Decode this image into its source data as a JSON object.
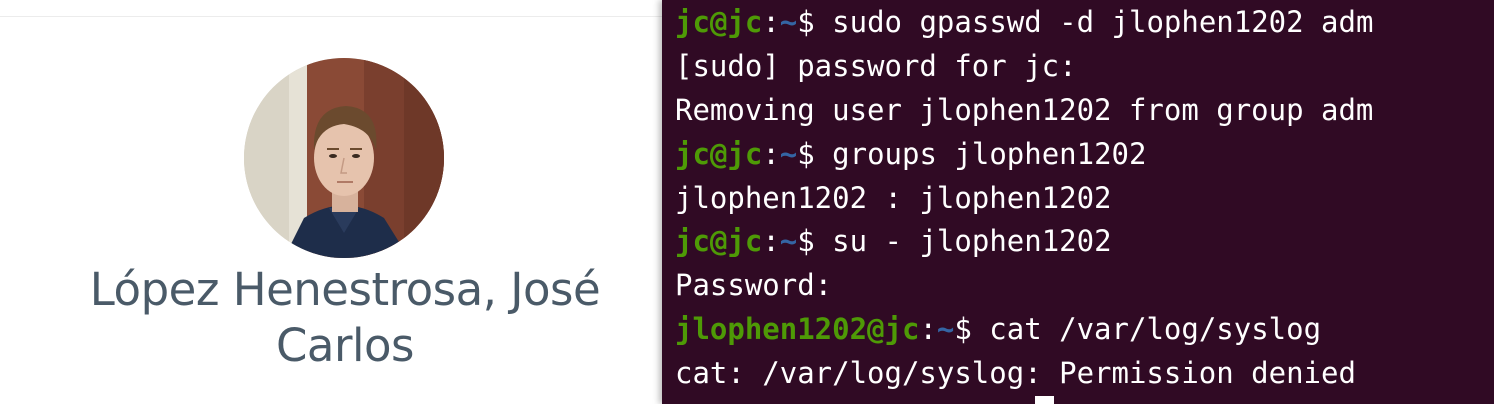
{
  "profile": {
    "name_line1": "López Henestrosa, José",
    "name_line2": "Carlos",
    "avatar_icon": "profile-photo"
  },
  "terminal": {
    "colors": {
      "background": "#300a24",
      "prompt_user": "#4e9a06",
      "prompt_path": "#3465a4",
      "text": "#ffffff"
    },
    "lines": [
      {
        "type": "prompt",
        "user": "jc@jc",
        "colon": ":",
        "path": "~",
        "dollar": "$",
        "command": " sudo gpasswd -d jlophen1202 adm"
      },
      {
        "type": "output",
        "text": "[sudo] password for jc:"
      },
      {
        "type": "output",
        "text": "Removing user jlophen1202 from group adm"
      },
      {
        "type": "prompt",
        "user": "jc@jc",
        "colon": ":",
        "path": "~",
        "dollar": "$",
        "command": " groups jlophen1202"
      },
      {
        "type": "output",
        "text": "jlophen1202 : jlophen1202"
      },
      {
        "type": "prompt",
        "user": "jc@jc",
        "colon": ":",
        "path": "~",
        "dollar": "$",
        "command": " su - jlophen1202"
      },
      {
        "type": "output",
        "text": "Password:"
      },
      {
        "type": "prompt",
        "user": "jlophen1202@jc",
        "colon": ":",
        "path": "~",
        "dollar": "$",
        "command": " cat /var/log/syslog"
      },
      {
        "type": "output",
        "text": "cat: /var/log/syslog: Permission denied"
      }
    ]
  }
}
